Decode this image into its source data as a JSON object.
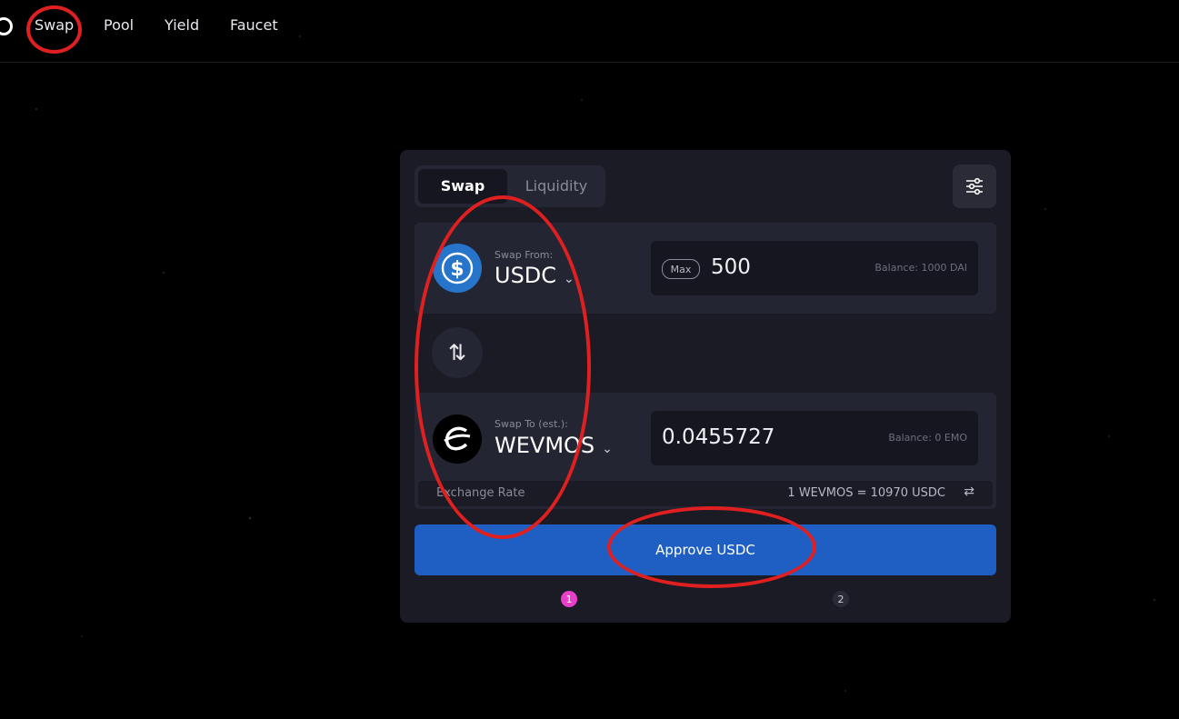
{
  "nav": {
    "items": [
      "Swap",
      "Pool",
      "Yield",
      "Faucet"
    ]
  },
  "card": {
    "tabs": [
      "Swap",
      "Liquidity"
    ],
    "from": {
      "label": "Swap From:",
      "token": "USDC",
      "max_label": "Max",
      "amount": "500",
      "balance": "Balance: 1000 DAI"
    },
    "to": {
      "label": "Swap To (est.):",
      "token": "WEVMOS",
      "amount": "0.0455727",
      "balance": "Balance: 0 EMO"
    },
    "rate": {
      "label": "Exchange Rate",
      "value": "1 WEVMOS = 10970 USDC"
    },
    "approve_label": "Approve USDC",
    "steps": [
      "1",
      "2"
    ]
  },
  "colors": {
    "accent": "#1f5fc4",
    "step_active": "#e83ec8",
    "annotation": "#e02020",
    "usdc": "#2775ca"
  }
}
